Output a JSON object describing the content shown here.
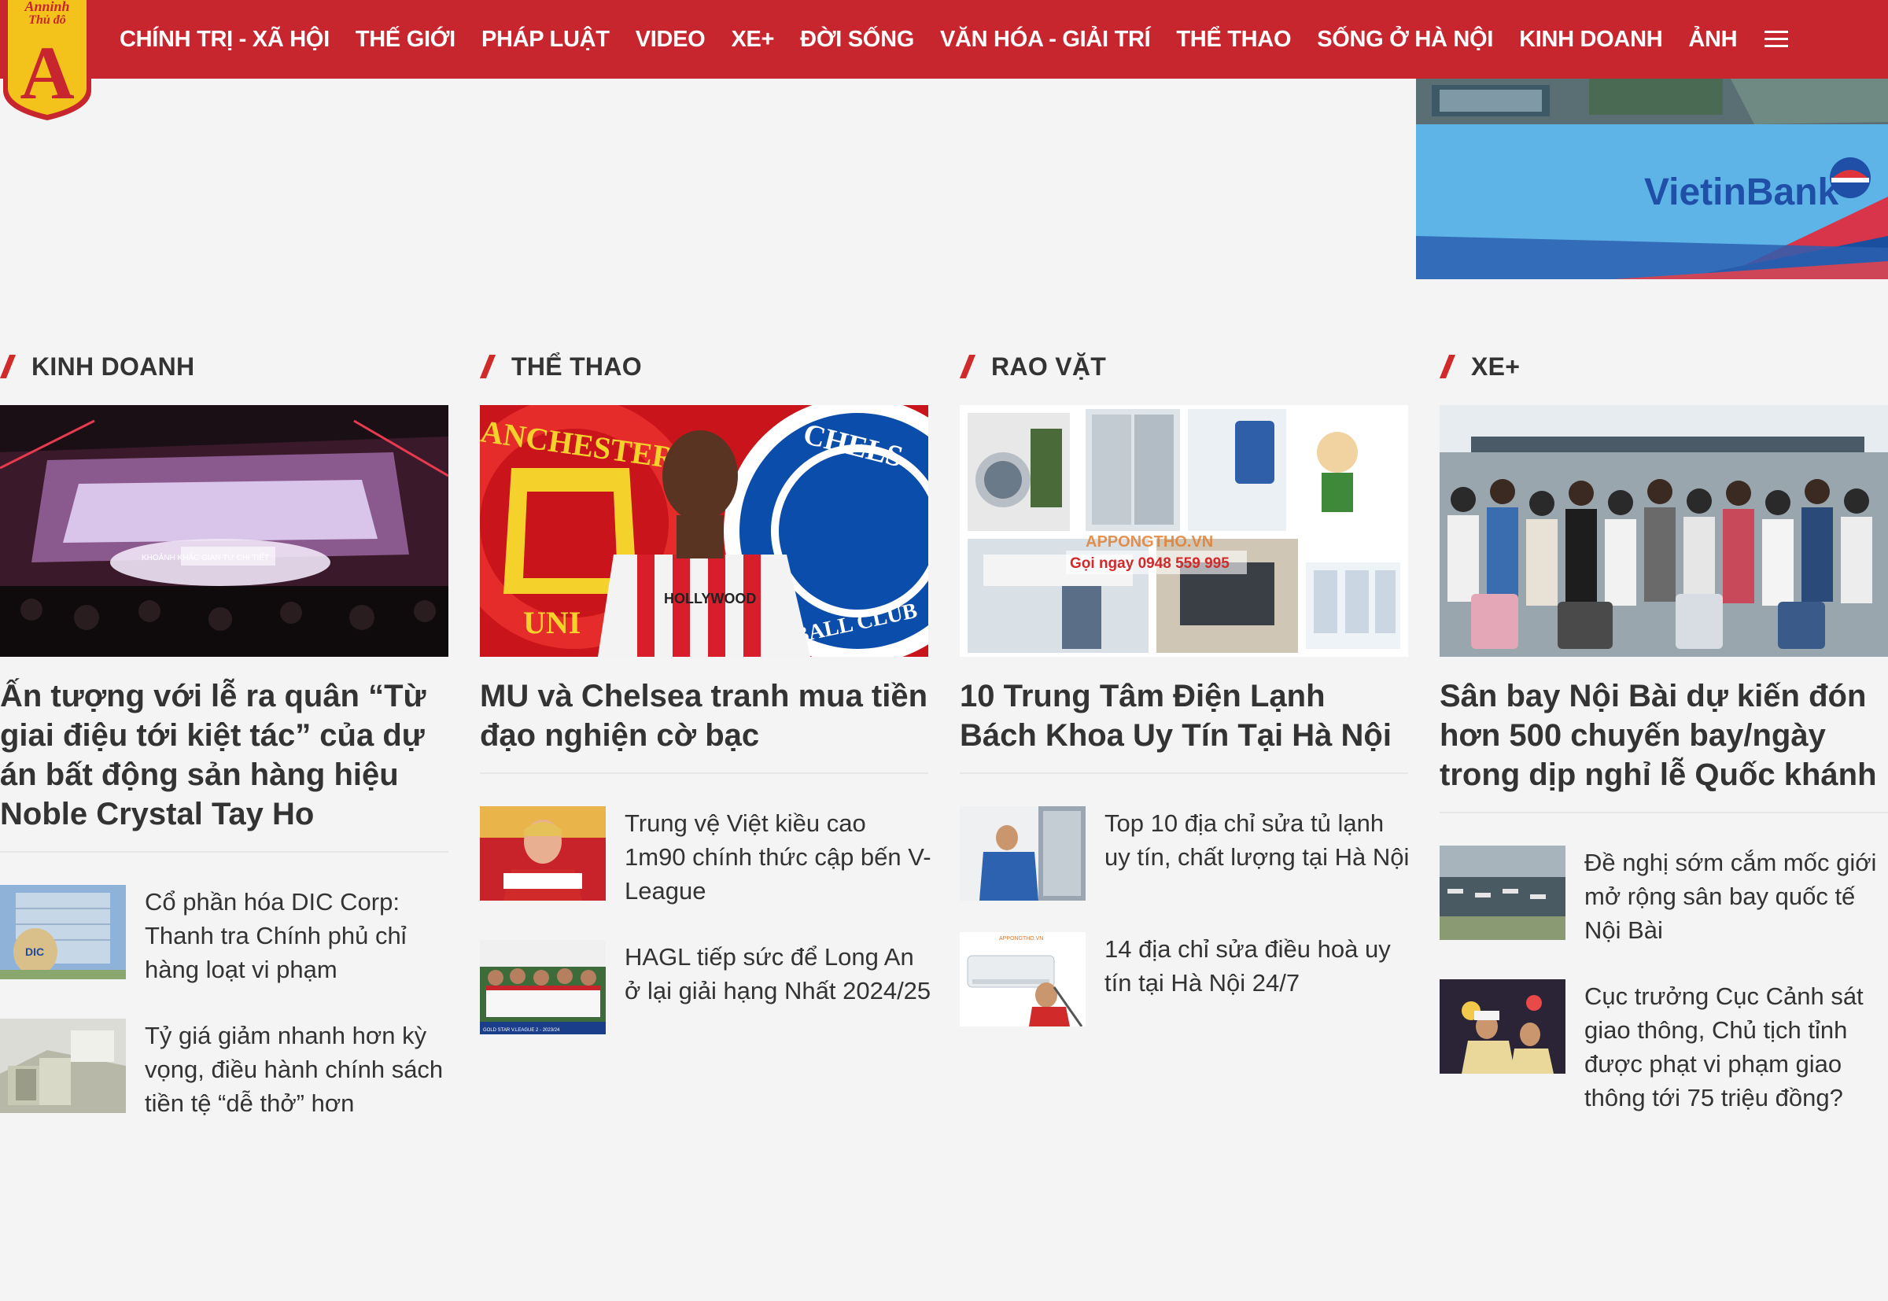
{
  "brand": {
    "logo_text_top": "Anninh Thủ đô",
    "logo_letter": "A",
    "color_primary": "#c8262e",
    "color_logo_yellow": "#f3c31c"
  },
  "nav": {
    "items": [
      "CHÍNH TRỊ - XÃ HỘI",
      "THẾ GIỚI",
      "PHÁP LUẬT",
      "VIDEO",
      "XE+",
      "ĐỜI SỐNG",
      "VĂN HÓA - GIẢI TRÍ",
      "THỂ THAO",
      "SỐNG Ở HÀ NỘI",
      "KINH DOANH",
      "ẢNH"
    ],
    "menu_icon": "hamburger-menu-icon"
  },
  "banner": {
    "brand_text": "VietinBank"
  },
  "sections": [
    {
      "title": "KINH DOANH",
      "lead_title": "Ấn tượng với lễ ra quân “Từ giai điệu tới kiệt tác” của dự án bất động sản hàng hiệu Noble Crystal Tay Ho",
      "lead_image_text": "KHOẢNH KHẮC GIAN TỪ CHI TIẾT",
      "items": [
        {
          "title": "Cổ phần hóa DIC Corp: Thanh tra Chính phủ chỉ hàng loạt vi phạm",
          "thumb_text": "DIC"
        },
        {
          "title": "Tỷ giá giảm nhanh hơn kỳ vọng, điều hành chính sách tiền tệ “dễ thở” hơn",
          "thumb_text": ""
        }
      ]
    },
    {
      "title": "THỂ THAO",
      "lead_title": "MU và Chelsea tranh mua tiền đạo nghiện cờ bạc",
      "lead_image_text": {
        "left_crest": "ANCHESTER",
        "left_crest_bottom": "UNI",
        "right_crest": "CHELS",
        "right_crest_bottom": "BALL CLUB",
        "shirt": "HOLLYWOOD"
      },
      "items": [
        {
          "title": "Trung vệ Việt kiều cao 1m90 chính thức cập bến V-League",
          "thumb_text": ""
        },
        {
          "title": "HAGL tiếp sức để Long An ở lại giải hạng Nhất 2024/25",
          "thumb_text": "GOLD STAR V.LEAGUE 2 - 2023/24"
        }
      ]
    },
    {
      "title": "RAO VẶT",
      "lead_title": "10 Trung Tâm Điện Lạnh Bách Khoa Uy Tín Tại Hà Nội",
      "lead_image_text": {
        "site": "APPONGTHO.VN",
        "phone": "Gọi ngay 0948 559 995"
      },
      "items": [
        {
          "title": "Top 10 địa chỉ sửa tủ lạnh uy tín, chất lượng tại Hà Nội",
          "thumb_text": ""
        },
        {
          "title": "14 địa chỉ sửa điều hoà uy tín tại Hà Nội 24/7",
          "thumb_text": "APPONGTHO.VN"
        }
      ]
    },
    {
      "title": "XE+",
      "lead_title": "Sân bay Nội Bài dự kiến đón hơn 500 chuyến bay/ngày trong dịp nghỉ lễ Quốc khánh",
      "lead_image_text": "",
      "items": [
        {
          "title": "Đề nghị sớm cắm mốc giới mở rộng sân bay quốc tế Nội Bài",
          "thumb_text": ""
        },
        {
          "title": "Cục trưởng Cục Cảnh sát giao thông, Chủ tịch tỉnh được phạt vi phạm giao thông tới 75 triệu đồng?",
          "thumb_text": ""
        }
      ]
    }
  ]
}
